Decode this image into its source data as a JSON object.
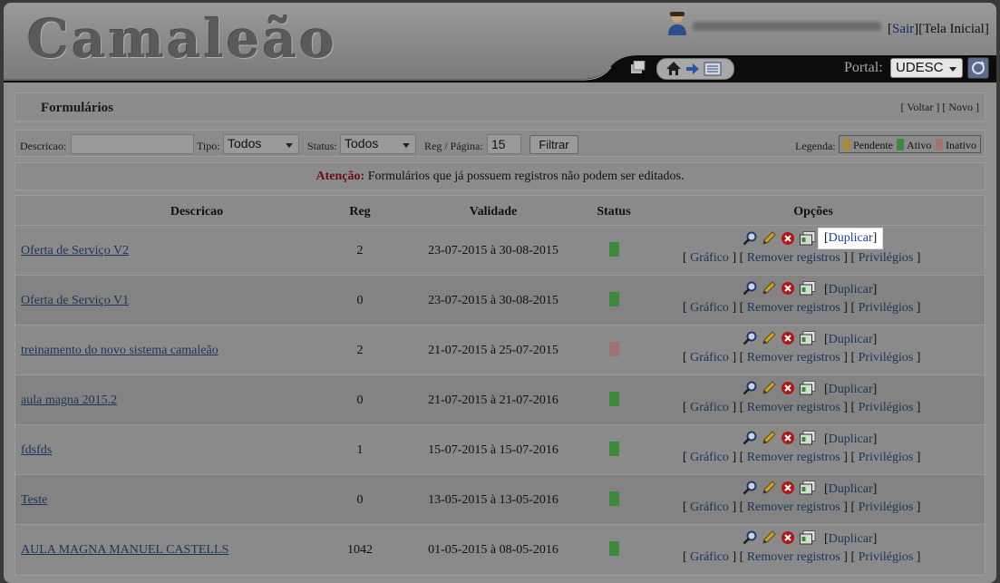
{
  "app": {
    "logo": "Camaleão",
    "top_links": {
      "sair": "Sair",
      "tela_inicial": "Tela Inicial"
    },
    "portal_label": "Portal:",
    "portal_value": "UDESC"
  },
  "page": {
    "title": "Formulários",
    "voltar": "Voltar",
    "novo": "Novo"
  },
  "filters": {
    "descricao_label": "Descricao:",
    "descricao_value": "",
    "tipo_label": "Tipo:",
    "tipo_value": "Todos",
    "status_label": "Status:",
    "status_value": "Todos",
    "reg_label": "Reg / Página:",
    "reg_value": "15",
    "filter_button": "Filtrar"
  },
  "legend": {
    "title": "Legenda:",
    "items": [
      {
        "label": "Pendente",
        "color": "#a88a34"
      },
      {
        "label": "Ativo",
        "color": "#3d8a3d"
      },
      {
        "label": "Inativo",
        "color": "#a07272"
      }
    ]
  },
  "alert": {
    "prefix": "Atenção:",
    "message": "Formulários que já possuem registros não podem ser editados."
  },
  "table": {
    "headers": [
      "Descricao",
      "Reg",
      "Validade",
      "Status",
      "Opções"
    ],
    "option_labels": {
      "duplicar": "Duplicar",
      "grafico": "Gráfico",
      "remover": "Remover registros",
      "privilegios": "Privilégios"
    },
    "rows": [
      {
        "descricao": "Oferta de Serviço V2",
        "reg": "2",
        "validade": "23-07-2015 à 30-08-2015",
        "status": "Ativo",
        "status_color": "#3d8a3d"
      },
      {
        "descricao": "Oferta de Serviço V1",
        "reg": "0",
        "validade": "23-07-2015 à 30-08-2015",
        "status": "Ativo",
        "status_color": "#3d8a3d"
      },
      {
        "descricao": "treinamento do novo sistema camaleão",
        "reg": "2",
        "validade": "21-07-2015 à 25-07-2015",
        "status": "Inativo",
        "status_color": "#a07272"
      },
      {
        "descricao": "aula magna 2015.2",
        "reg": "0",
        "validade": "21-07-2015 à 21-07-2016",
        "status": "Ativo",
        "status_color": "#3d8a3d"
      },
      {
        "descricao": "fdsfds",
        "reg": "1",
        "validade": "15-07-2015 à 15-07-2016",
        "status": "Ativo",
        "status_color": "#3d8a3d"
      },
      {
        "descricao": "Teste",
        "reg": "0",
        "validade": "13-05-2015 à 13-05-2016",
        "status": "Ativo",
        "status_color": "#3d8a3d"
      },
      {
        "descricao": "AULA MAGNA MANUEL CASTELLS",
        "reg": "1042",
        "validade": "01-05-2015 à 08-05-2016",
        "status": "Ativo",
        "status_color": "#3d8a3d"
      }
    ]
  }
}
